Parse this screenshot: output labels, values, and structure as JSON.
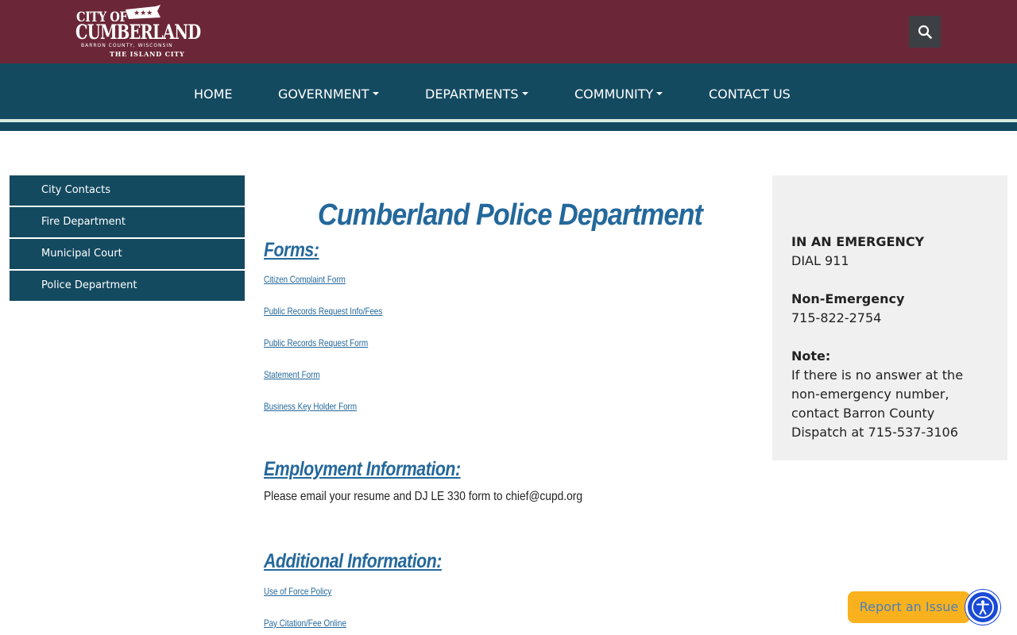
{
  "header": {
    "logo": {
      "line1": "CITY OF",
      "line2": "CUMBERLAND",
      "line3": "BARRON COUNTY, WISCONSIN",
      "line4": "THE ISLAND CITY"
    },
    "search_icon": "search-icon"
  },
  "nav": {
    "items": [
      {
        "label": "HOME",
        "dropdown": false
      },
      {
        "label": "GOVERNMENT",
        "dropdown": true
      },
      {
        "label": "DEPARTMENTS",
        "dropdown": true
      },
      {
        "label": "COMMUNITY",
        "dropdown": true
      },
      {
        "label": "CONTACT US",
        "dropdown": false
      }
    ]
  },
  "sidebar": {
    "items": [
      {
        "label": "City Contacts"
      },
      {
        "label": "Fire Department"
      },
      {
        "label": "Municipal Court"
      },
      {
        "label": "Police Department"
      }
    ]
  },
  "main": {
    "title": "Cumberland Police Department",
    "forms": {
      "heading": "Forms:",
      "links": [
        "Citizen Complaint Form",
        "Public Records Request Info/Fees",
        "Public Records Request Form",
        "Statement Form",
        "Business Key Holder Form"
      ]
    },
    "employment": {
      "heading": "Employment Information:",
      "text": "Please email your resume and DJ LE 330 form to chief@cupd.org"
    },
    "additional": {
      "heading": "Additional Information:",
      "links": [
        "Use of Force Policy",
        "Pay Citation/Fee Online"
      ]
    }
  },
  "emergency": {
    "emergency_label": "IN AN EMERGENCY",
    "emergency_value": "DIAL 911",
    "non_emergency_label": "Non-Emergency",
    "non_emergency_value": "715-822-2754",
    "note_label": "Note:",
    "note_text": "If there is no answer at the non-emergency number, contact Barron County Dispatch at 715-537-3106"
  },
  "floating": {
    "report_label": "Report an Issue",
    "accessibility_icon": "accessibility-icon"
  },
  "colors": {
    "header_bg": "#6b2738",
    "nav_bg": "#144a60",
    "link": "#24689b",
    "report_bg": "#f9b21d",
    "a11y_bg": "#1a4ad6"
  }
}
